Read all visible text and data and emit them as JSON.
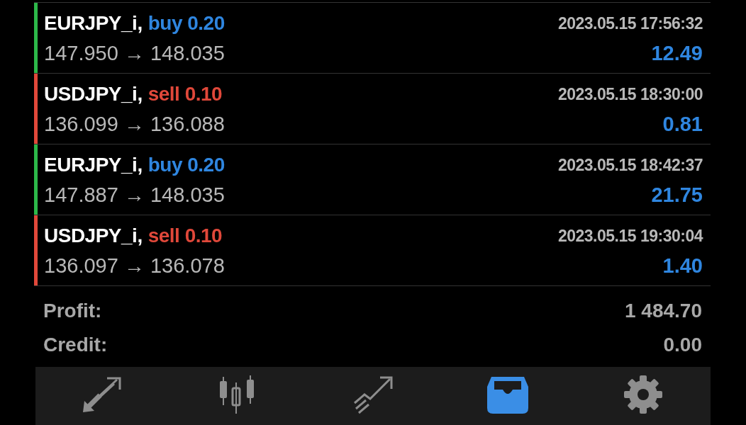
{
  "deals": [
    {
      "symbol": "EURJPY_i,",
      "kind": "buy",
      "type_label": "buy 0.20",
      "time": "2023.05.15 17:56:32",
      "prices": "147.950 → 148.035",
      "profit": "12.49"
    },
    {
      "symbol": "USDJPY_i,",
      "kind": "sell",
      "type_label": "sell 0.10",
      "time": "2023.05.15 18:30:00",
      "prices": "136.099 → 136.088",
      "profit": "0.81"
    },
    {
      "symbol": "EURJPY_i,",
      "kind": "buy",
      "type_label": "buy 0.20",
      "time": "2023.05.15 18:42:37",
      "prices": "147.887 → 148.035",
      "profit": "21.75"
    },
    {
      "symbol": "USDJPY_i,",
      "kind": "sell",
      "type_label": "sell 0.10",
      "time": "2023.05.15 19:30:04",
      "prices": "136.097 → 136.078",
      "profit": "1.40"
    }
  ],
  "summary": [
    {
      "label": "Profit:",
      "value": "1 484.70"
    },
    {
      "label": "Credit:",
      "value": "0.00"
    }
  ],
  "tabs": [
    {
      "kind": "trade",
      "selected": false
    },
    {
      "kind": "chart",
      "selected": false
    },
    {
      "kind": "analytics",
      "selected": false
    },
    {
      "kind": "history",
      "selected": true
    },
    {
      "kind": "settings",
      "selected": false
    }
  ]
}
